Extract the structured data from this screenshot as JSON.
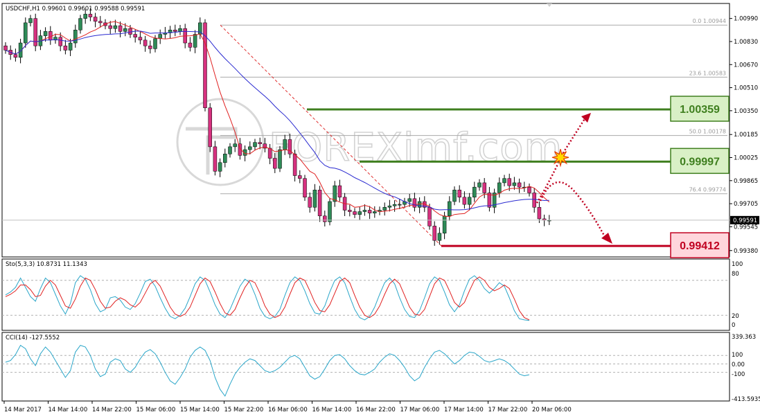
{
  "header": {
    "symbol_label": "USDCHF,H1  0.99601 0.99601 0.99588 0.99591",
    "watermark": "FOREXimf.com"
  },
  "price_axis": {
    "ticks": [
      "1.00990",
      "1.00830",
      "1.00670",
      "1.00510",
      "1.00350",
      "1.00185",
      "1.00025",
      "0.99865",
      "0.99705",
      "0.99545",
      "0.99380"
    ],
    "current_price": "0.99591"
  },
  "fibonacci": {
    "levels": [
      {
        "label": "0.0  1.00944",
        "price": 1.00944
      },
      {
        "label": "23.6  1.00583",
        "price": 1.00583
      },
      {
        "label": "50.0  1.00178",
        "price": 1.00178
      },
      {
        "label": "76.4  0.99774",
        "price": 0.99774
      }
    ]
  },
  "levels": {
    "resistance_1": {
      "label": "1.00359",
      "price": 1.00359
    },
    "resistance_2": {
      "label": "0.99997",
      "price": 0.99997
    },
    "support_1": {
      "label": "0.99412",
      "price": 0.99412
    }
  },
  "stochastic": {
    "label": "Sto(5,3,3) 10.8731 11.1343",
    "axis": [
      "100",
      "80",
      "20",
      "0"
    ]
  },
  "cci": {
    "label": "CCI(14) -127.5552",
    "axis": [
      "339.363",
      "100",
      "0.00",
      "-100",
      "-413.5935"
    ]
  },
  "time_axis": [
    "14 Mar 2017",
    "14 Mar 14:00",
    "14 Mar 22:00",
    "15 Mar 06:00",
    "15 Mar 14:00",
    "15 Mar 22:00",
    "16 Mar 06:00",
    "16 Mar 14:00",
    "16 Mar 22:00",
    "17 Mar 06:00",
    "17 Mar 14:00",
    "17 Mar 22:00",
    "20 Mar 06:00"
  ],
  "colors": {
    "bull_candle": "#2e8b57",
    "bear_candle": "#d6317f",
    "ma_fast": "#e02020",
    "ma_slow": "#2a2ad0",
    "resistance": "#3f7f1f",
    "support": "#c00020",
    "stoch_main": "#2aa6c9",
    "stoch_signal": "#e02020",
    "cci_line": "#2aa6c9"
  },
  "chart_data": [
    {
      "type": "candlestick",
      "title": "USDCHF,H1",
      "ohlc_header": {
        "open": 0.99601,
        "high": 0.99601,
        "low": 0.99588,
        "close": 0.99591
      },
      "ylim": [
        0.9935,
        1.0107
      ],
      "closes": [
        1.0077,
        1.0074,
        1.0072,
        1.0082,
        1.0096,
        1.0099,
        1.008,
        1.0087,
        1.009,
        1.0084,
        1.0086,
        1.008,
        1.0077,
        1.0082,
        1.0091,
        1.0099,
        1.0102,
        1.01,
        1.0097,
        1.0096,
        1.0094,
        1.0092,
        1.0094,
        1.009,
        1.0092,
        1.0088,
        1.0086,
        1.0084,
        1.008,
        1.0078,
        1.0085,
        1.0088,
        1.0089,
        1.0091,
        1.009,
        1.0092,
        1.0082,
        1.0079,
        1.0088,
        1.0096,
        1.0037,
        1.001,
        0.9993,
        0.9999,
        1.0005,
        1.001,
        1.0012,
        1.0004,
        1.0008,
        1.001,
        1.0013,
        1.0012,
        1.0009,
        1.0002,
        0.9995,
        1.0008,
        1.0015,
        1.0005,
        0.999,
        0.9988,
        0.9975,
        0.9968,
        0.998,
        0.9962,
        0.9958,
        0.9972,
        0.9983,
        0.9975,
        0.9966,
        0.9965,
        0.9963,
        0.9965,
        0.9966,
        0.9964,
        0.9965,
        0.9966,
        0.9968,
        0.9969,
        0.997,
        0.997,
        0.9972,
        0.9974,
        0.9968,
        0.9972,
        0.9968,
        0.9955,
        0.9945,
        0.995,
        0.9962,
        0.9972,
        0.998,
        0.9975,
        0.997,
        0.9975,
        0.9982,
        0.9985,
        0.9978,
        0.9968,
        0.9978,
        0.9985,
        0.9988,
        0.9983,
        0.9985,
        0.9982,
        0.9982,
        0.9978,
        0.9968,
        0.996,
        0.9959,
        0.9959
      ]
    },
    {
      "type": "line",
      "title": "Sto(5,3,3)",
      "ylim": [
        0,
        100
      ],
      "series": [
        {
          "name": "10.8731",
          "values": [
            55,
            60,
            68,
            84,
            68,
            52,
            44,
            66,
            84,
            76,
            56,
            36,
            22,
            40,
            76,
            88,
            82,
            64,
            40,
            26,
            30,
            50,
            52,
            46,
            34,
            30,
            40,
            58,
            78,
            82,
            70,
            50,
            32,
            18,
            14,
            20,
            32,
            52,
            74,
            86,
            80,
            60,
            38,
            22,
            16,
            30,
            50,
            70,
            82,
            76,
            56,
            32,
            18,
            14,
            18,
            30,
            54,
            76,
            86,
            80,
            62,
            40,
            24,
            22,
            36,
            60,
            80,
            86,
            76,
            52,
            30,
            16,
            12,
            18,
            34,
            56,
            76,
            84,
            74,
            50,
            30,
            18,
            16,
            28,
            50,
            74,
            86,
            80,
            60,
            38,
            26,
            38,
            62,
            82,
            88,
            80,
            66,
            58,
            66,
            76,
            70,
            50,
            28,
            14,
            12,
            11
          ]
        },
        {
          "name": "11.1343",
          "values": [
            52,
            56,
            62,
            72,
            72,
            64,
            52,
            54,
            70,
            80,
            72,
            54,
            36,
            32,
            48,
            70,
            84,
            80,
            64,
            44,
            32,
            34,
            44,
            50,
            46,
            38,
            34,
            42,
            58,
            74,
            80,
            70,
            52,
            34,
            22,
            18,
            22,
            34,
            54,
            74,
            84,
            78,
            60,
            40,
            24,
            20,
            30,
            50,
            68,
            80,
            76,
            58,
            36,
            22,
            16,
            20,
            34,
            56,
            76,
            84,
            80,
            62,
            42,
            28,
            26,
            38,
            58,
            78,
            84,
            76,
            54,
            34,
            20,
            16,
            22,
            36,
            56,
            74,
            82,
            74,
            54,
            34,
            22,
            20,
            30,
            52,
            74,
            84,
            80,
            62,
            42,
            34,
            42,
            62,
            80,
            86,
            80,
            68,
            62,
            66,
            72,
            66,
            48,
            28,
            16,
            12
          ]
        }
      ],
      "levels": [
        80,
        20
      ]
    },
    {
      "type": "line",
      "title": "CCI(14)",
      "ylim": [
        -413.5935,
        339.363
      ],
      "series": [
        {
          "name": "-127.5552",
          "values": [
            20,
            40,
            110,
            220,
            180,
            60,
            -20,
            120,
            200,
            140,
            40,
            -60,
            -160,
            -80,
            140,
            220,
            200,
            100,
            -60,
            -150,
            -120,
            20,
            60,
            40,
            -60,
            -100,
            -40,
            60,
            140,
            170,
            120,
            20,
            -100,
            -200,
            -240,
            -160,
            -60,
            80,
            160,
            200,
            160,
            40,
            -160,
            -300,
            -380,
            -240,
            -120,
            -40,
            20,
            60,
            40,
            -20,
            -80,
            -100,
            -80,
            -40,
            20,
            80,
            100,
            60,
            -40,
            -140,
            -180,
            -150,
            -60,
            40,
            100,
            110,
            60,
            -20,
            -80,
            -120,
            -130,
            -100,
            -60,
            20,
            80,
            120,
            100,
            40,
            -40,
            -140,
            -200,
            -160,
            -40,
            60,
            140,
            160,
            120,
            60,
            0,
            40,
            100,
            140,
            130,
            90,
            40,
            20,
            40,
            60,
            40,
            0,
            -60,
            -120,
            -140,
            -128
          ]
        }
      ],
      "levels": [
        100,
        0,
        -100
      ]
    }
  ]
}
